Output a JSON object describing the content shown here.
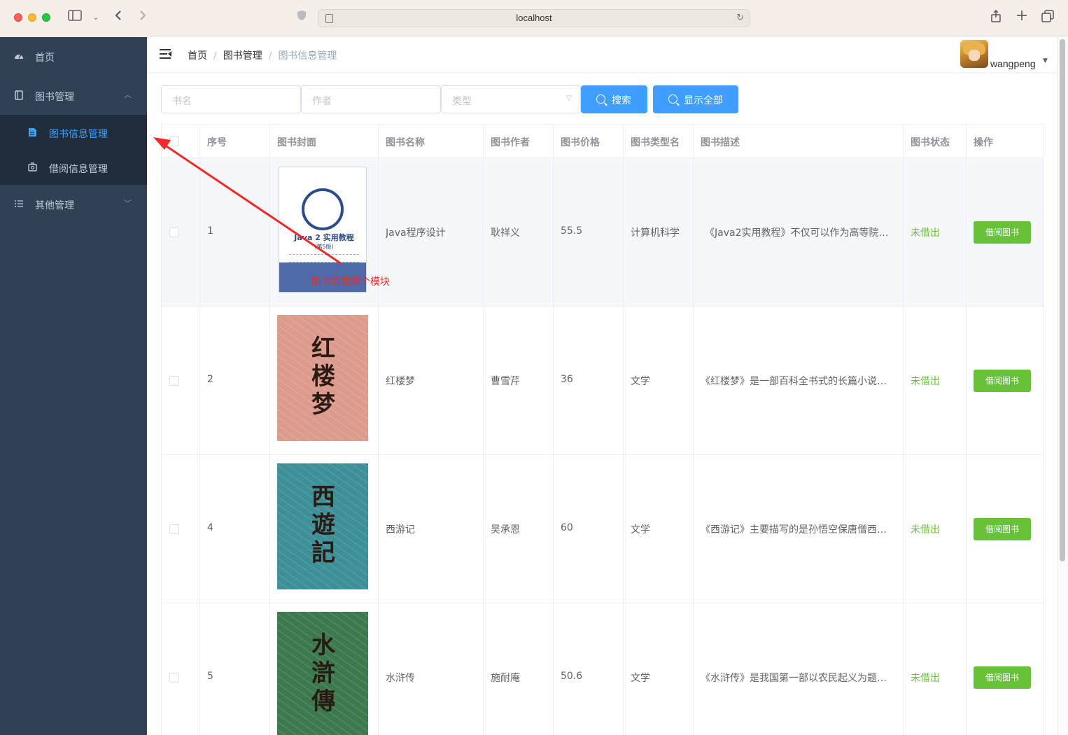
{
  "browser": {
    "url": "localhost"
  },
  "sidebar": {
    "items": [
      {
        "label": "首页"
      },
      {
        "label": "图书管理"
      },
      {
        "label": "其他管理"
      }
    ],
    "sub_items": [
      {
        "label": "图书信息管理",
        "active": true
      },
      {
        "label": "借阅信息管理",
        "active": false
      }
    ]
  },
  "header": {
    "breadcrumb": [
      "首页",
      "图书管理",
      "图书信息管理"
    ],
    "user": "wangpeng"
  },
  "search": {
    "name_placeholder": "书名",
    "author_placeholder": "作者",
    "type_placeholder": "类型",
    "search_label": "搜索",
    "show_all_label": "显示全部"
  },
  "table": {
    "columns": [
      "序号",
      "图书封面",
      "图书名称",
      "图书作者",
      "图书价格",
      "图书类型名",
      "图书描述",
      "图书状态",
      "操作"
    ],
    "rows": [
      {
        "id": "1",
        "name": "Java程序设计",
        "author": "耿祥义",
        "price": "55.5",
        "type": "计算机科学",
        "desc": "《Java2实用教程》不仅可以作为高等院…",
        "status": "未借出",
        "action": "借阅图书",
        "cover_title": "Java 2 实用教程",
        "cover_sub": "(第5版)"
      },
      {
        "id": "2",
        "name": "红楼梦",
        "author": "曹雪芹",
        "price": "36",
        "type": "文学",
        "desc": "《红楼梦》是一部百科全书式的长篇小说…",
        "status": "未借出",
        "action": "借阅图书",
        "cover_title": "红楼梦"
      },
      {
        "id": "4",
        "name": "西游记",
        "author": "吴承恩",
        "price": "60",
        "type": "文学",
        "desc": "《西游记》主要描写的是孙悟空保唐僧西…",
        "status": "未借出",
        "action": "借阅图书",
        "cover_title": "西遊記"
      },
      {
        "id": "5",
        "name": "水浒传",
        "author": "施耐庵",
        "price": "50.6",
        "type": "文学",
        "desc": "《水浒传》是我国第一部以农民起义为题…",
        "status": "未借出",
        "action": "借阅图书",
        "cover_title": "水滸傳"
      }
    ]
  },
  "annotation": {
    "text": "图书管理两个模块",
    "color": "#ee2a2a"
  },
  "colors": {
    "sidebar_bg": "#304156",
    "submenu_bg": "#1f2d3d",
    "active": "#409eff",
    "success": "#67c23a"
  }
}
